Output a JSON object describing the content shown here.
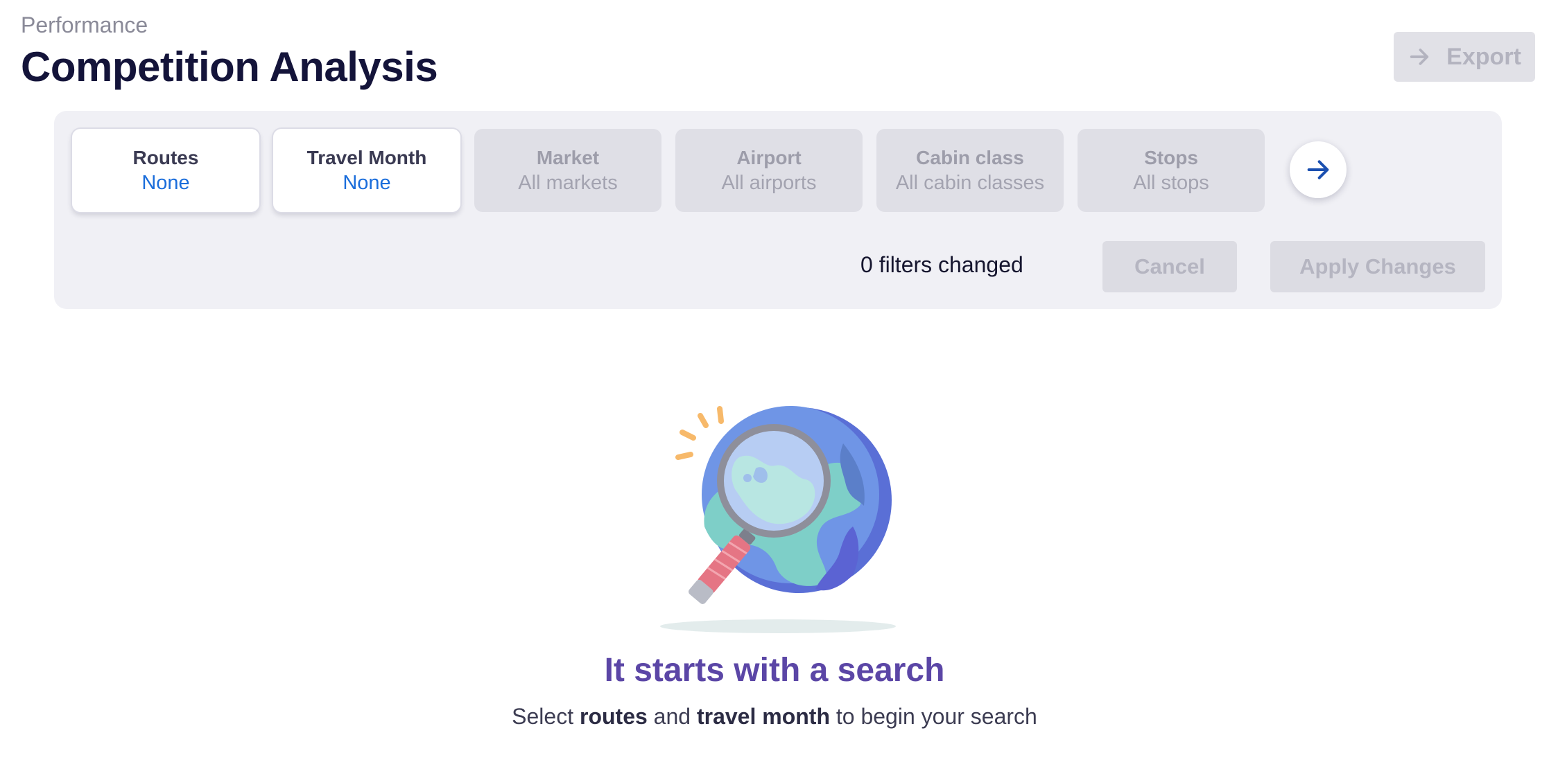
{
  "header": {
    "breadcrumb": "Performance",
    "title": "Competition Analysis",
    "export_label": "Export",
    "export_icon": "arrow-right-icon"
  },
  "filters": {
    "cards": [
      {
        "title": "Routes",
        "value": "None",
        "state": "active"
      },
      {
        "title": "Travel Month",
        "value": "None",
        "state": "active"
      },
      {
        "title": "Market",
        "value": "All markets",
        "state": "disabled"
      },
      {
        "title": "Airport",
        "value": "All airports",
        "state": "disabled"
      },
      {
        "title": "Cabin class",
        "value": "All cabin classes",
        "state": "disabled"
      },
      {
        "title": "Stops",
        "value": "All stops",
        "state": "disabled"
      }
    ],
    "next_icon": "arrow-right-icon",
    "changed_text": "0 filters changed",
    "cancel_label": "Cancel",
    "apply_label": "Apply Changes"
  },
  "empty_state": {
    "illustration": "globe-magnifier-illustration",
    "title": "It starts with a search",
    "subtitle": {
      "part1": "Select ",
      "bold1": "routes",
      "part2": " and ",
      "bold2": "travel month",
      "part3": " to begin your search"
    }
  },
  "colors": {
    "accent_blue": "#1a6ddb",
    "title_purple": "#5b46a6",
    "disabled_bg": "#dfdfe6",
    "panel_bg": "#f0f0f5"
  }
}
